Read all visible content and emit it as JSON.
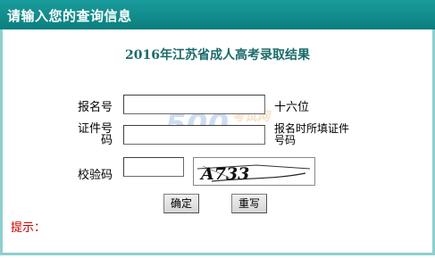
{
  "header": {
    "title": "请输入您的查询信息"
  },
  "main": {
    "title": "2016年江苏省成人高考录取结果"
  },
  "form": {
    "reg_no": {
      "label": "报名号",
      "value": "",
      "hint": "十六位"
    },
    "id_no": {
      "label_line1": "证件号",
      "label_line2": "码",
      "value": "",
      "hint_line1": "报名时所填证件",
      "hint_line2": "号码"
    },
    "captcha": {
      "label": "校验码",
      "value": "",
      "image_text": "A733"
    }
  },
  "buttons": {
    "confirm": "确定",
    "reset": "重写"
  },
  "tips": {
    "label": "提示："
  },
  "watermark": {
    "big": "500",
    "small": "考试网"
  },
  "colors": {
    "header": "#0b7e7e",
    "border": "#8dcfcf",
    "title": "#1b6b6b",
    "tip": "#cc0000"
  }
}
